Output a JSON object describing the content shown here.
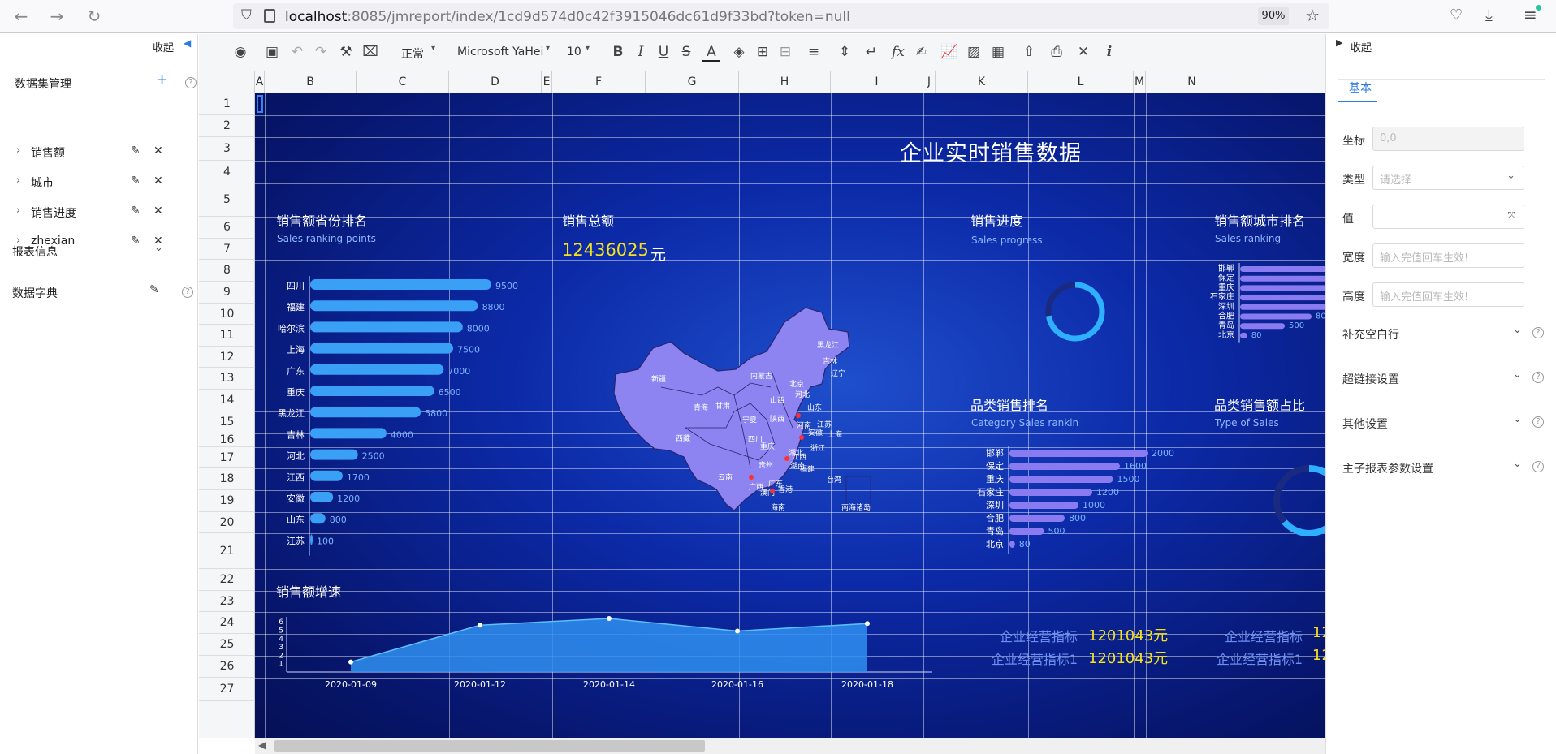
{
  "browser": {
    "url_host": "localhost",
    "url_rest": ":8085/jmreport/index/1cd9d574d0c42f3915046dc61d9f33bd?token=null",
    "zoom": "90%"
  },
  "left_panel": {
    "collapse": "收起",
    "dataset_title": "数据集管理",
    "datasets": [
      "销售额",
      "城市",
      "销售进度",
      "zhexian"
    ],
    "report_info": "报表信息",
    "dict": "数据字典"
  },
  "toolbar": {
    "format": "正常",
    "font": "Microsoft YaHei",
    "size": "10"
  },
  "columns": [
    "A",
    "B",
    "C",
    "D",
    "E",
    "F",
    "G",
    "H",
    "I",
    "J",
    "K",
    "L",
    "M",
    "N"
  ],
  "rows": [
    "1",
    "2",
    "3",
    "4",
    "5",
    "6",
    "7",
    "8",
    "9",
    "10",
    "11",
    "12",
    "13",
    "14",
    "15",
    "16",
    "17",
    "18",
    "19",
    "20",
    "21",
    "22",
    "23",
    "24",
    "25",
    "26",
    "27"
  ],
  "report": {
    "title": "企业实时销售数据",
    "p1": {
      "title": "销售额省份排名",
      "sub": "Sales ranking points"
    },
    "p2": {
      "title": "销售总额",
      "value": "12436025",
      "unit": "元"
    },
    "p3": {
      "title": "销售进度",
      "sub": "Sales progress"
    },
    "p4": {
      "title": "销售额城市排名",
      "sub": "Sales ranking"
    },
    "p5": {
      "title": "品类销售排名",
      "sub": "Category Sales  rankin"
    },
    "p6": {
      "title": "品类销售额占比",
      "sub": "Type of Sales"
    },
    "p7": {
      "title": "销售额增速"
    },
    "kpi": [
      {
        "label": "企业经营指标",
        "value": "1201043元"
      },
      {
        "label": "企业经营指标1",
        "value": "1201043元"
      }
    ],
    "kpi_right": [
      {
        "label": "企业经营指标",
        "value": "12"
      },
      {
        "label": "企业经营指标1",
        "value": "12"
      }
    ],
    "map_labels": [
      "新疆",
      "西藏",
      "青海",
      "内蒙古",
      "黑龙江",
      "吉林",
      "辽宁",
      "北京",
      "山西",
      "陕西",
      "河南",
      "四川",
      "重庆",
      "湖北",
      "安徽",
      "江苏",
      "浙江",
      "湖南",
      "贵州",
      "云南",
      "广西",
      "广东",
      "福建",
      "台湾",
      "香港",
      "澳门",
      "海南",
      "甘肃",
      "宁夏",
      "山东",
      "河北",
      "江西",
      "上海",
      "南海诸岛"
    ]
  },
  "chart_data": [
    {
      "type": "bar",
      "orientation": "horizontal",
      "title": "销售额省份排名",
      "categories": [
        "四川",
        "福建",
        "哈尔滨",
        "上海",
        "广东",
        "重庆",
        "黑龙江",
        "吉林",
        "河北",
        "江西",
        "安徽",
        "山东",
        "江苏"
      ],
      "values": [
        9500,
        8800,
        8000,
        7500,
        7000,
        6500,
        5800,
        4000,
        2500,
        1700,
        1200,
        800,
        100
      ],
      "color": "#3aa0f5"
    },
    {
      "type": "bar",
      "orientation": "horizontal",
      "title": "销售额城市排名",
      "categories": [
        "邯郸",
        "保定",
        "重庆",
        "石家庄",
        "深圳",
        "合肥",
        "青岛",
        "北京"
      ],
      "values": [
        2000,
        1600,
        1500,
        1200,
        1000,
        800,
        500,
        80
      ],
      "color": "#8a7cf0"
    },
    {
      "type": "bar",
      "orientation": "horizontal",
      "title": "品类销售排名",
      "categories": [
        "邯郸",
        "保定",
        "重庆",
        "石家庄",
        "深圳",
        "合肥",
        "青岛",
        "北京"
      ],
      "values": [
        2000,
        1600,
        1500,
        1200,
        1000,
        800,
        500,
        80
      ],
      "color": "#8a7cf0"
    },
    {
      "type": "area",
      "title": "销售额增速",
      "x": [
        "2020-01-09",
        "2020-01-12",
        "2020-01-14",
        "2020-01-16",
        "2020-01-18"
      ],
      "values": [
        1.2,
        5.6,
        6.4,
        4.9,
        5.8
      ],
      "yticks": [
        "1",
        "2",
        "3",
        "4",
        "5",
        "6"
      ]
    }
  ],
  "right_panel": {
    "collapse": "收起",
    "tab": "基本",
    "coord_label": "坐标",
    "coord_value": "0,0",
    "type_label": "类型",
    "type_ph": "请选择",
    "value_label": "值",
    "width_label": "宽度",
    "width_ph": "输入完值回车生效!",
    "height_label": "高度",
    "height_ph": "输入完值回车生效!",
    "sections": [
      "补充空白行",
      "超链接设置",
      "其他设置",
      "主子报表参数设置"
    ]
  }
}
